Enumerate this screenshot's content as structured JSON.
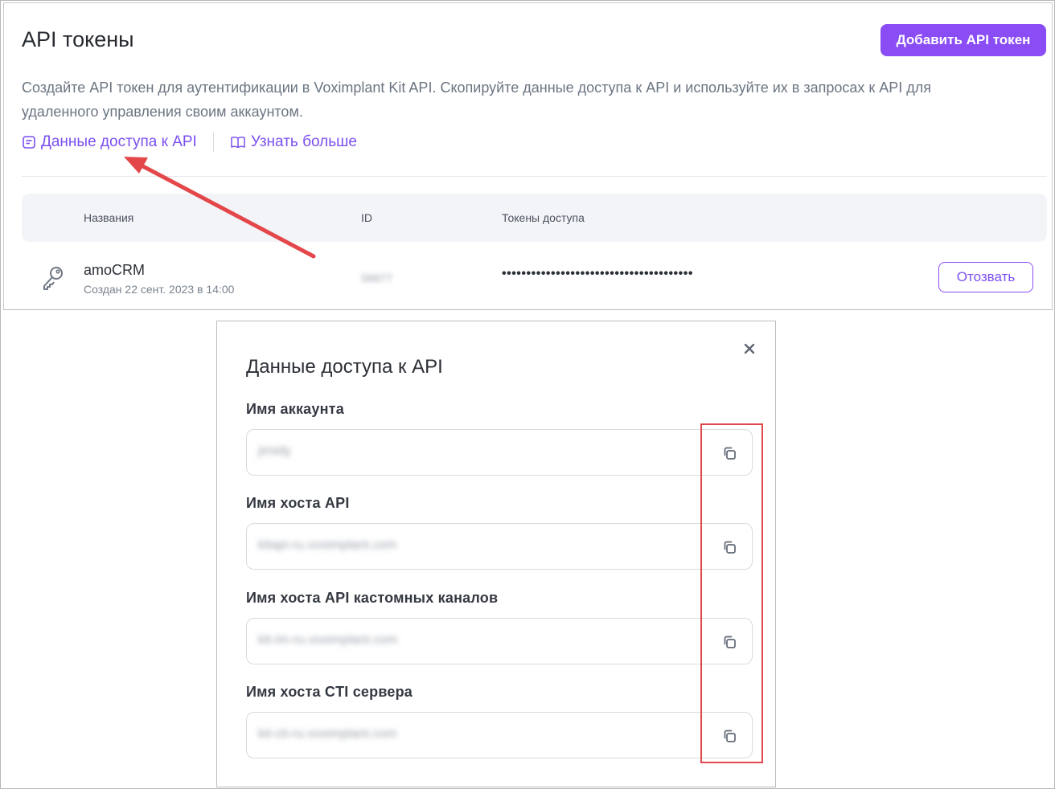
{
  "page": {
    "title": "API токены",
    "add_button": "Добавить API токен",
    "description": "Создайте API токен для аутентификации в Voximplant Kit API. Скопируйте данные доступа к API и используйте их в запросах к API для удаленного управления своим аккаунтом.",
    "links": {
      "access_data": "Данные доступа к API",
      "learn_more": "Узнать больше"
    }
  },
  "table": {
    "headers": {
      "name": "Названия",
      "id": "ID",
      "tokens": "Токены доступа"
    },
    "rows": [
      {
        "name": "amoCRM",
        "created": "Создан 22 сент. 2023 в 14:00",
        "id": "56877",
        "token": "•••••••••••••••••••••••••••••••••••••••",
        "action": "Отозвать"
      }
    ]
  },
  "modal": {
    "title": "Данные доступа к API",
    "fields": [
      {
        "label": "Имя аккаунта",
        "value": "jimidy"
      },
      {
        "label": "Имя хоста API",
        "value": "kitapi-ru.voximplant.com"
      },
      {
        "label": "Имя хоста API кастомных каналов",
        "value": "kit-im-ru.voximplant.com"
      },
      {
        "label": "Имя хоста CTI сервера",
        "value": "kit-cti-ru.voximplant.com"
      }
    ]
  },
  "icons": {
    "close": "close-icon",
    "copy": "copy-icon",
    "key": "key-icon",
    "document": "document-icon",
    "book": "book-icon"
  },
  "colors": {
    "accent": "#8a4cf4",
    "link": "#7b4ff0",
    "annotation": "#e0474c"
  }
}
